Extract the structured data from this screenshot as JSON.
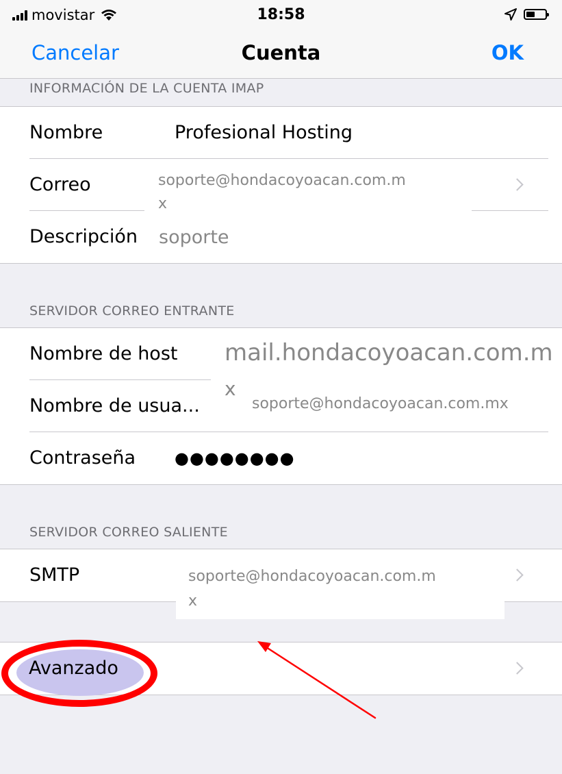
{
  "status_bar": {
    "carrier": "movistar",
    "time": "18:58",
    "wifi_icon": "wifi-icon",
    "location_icon": "location-arrow-icon",
    "battery_icon": "battery-icon"
  },
  "nav": {
    "cancel_label": "Cancelar",
    "title": "Cuenta",
    "ok_label": "OK",
    "accent_color": "#007aff"
  },
  "imap_section": {
    "header": "INFORMACIÓN DE LA CUENTA IMAP",
    "nombre_label": "Nombre",
    "nombre_value": "Profesional Hosting",
    "correo_label": "Correo",
    "correo_value_line1": "soporte@hondacoyoacan.com.m",
    "correo_value_line2": "x",
    "descripcion_label": "Descripción",
    "descripcion_value": "soporte"
  },
  "incoming_section": {
    "header": "SERVIDOR CORREO ENTRANTE",
    "host_label": "Nombre de host",
    "host_value_line1": "mail.hondacoyoacan.com.m",
    "host_value_line2": "x",
    "user_label": "Nombre de usua...",
    "user_value": "soporte@hondacoyoacan.com.mx",
    "password_label": "Contraseña",
    "password_value": "●●●●●●●●"
  },
  "outgoing_section": {
    "header": "SERVIDOR CORREO SALIENTE",
    "smtp_label": "SMTP",
    "smtp_value_line1": "soporte@hondacoyoacan.com.m",
    "smtp_value_line2": "x"
  },
  "advanced": {
    "label": "Avanzado",
    "highlight_color": "#ff0000"
  }
}
